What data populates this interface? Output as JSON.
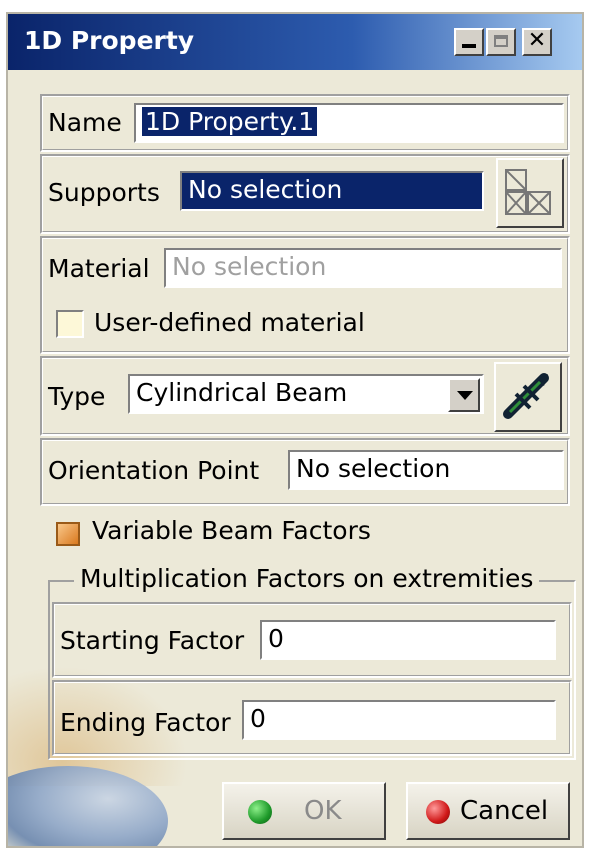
{
  "window": {
    "title": "1D Property",
    "minimize_label": "",
    "maximize_label": "",
    "close_label": "✕"
  },
  "name": {
    "label": "Name",
    "value": "1D Property.1"
  },
  "supports": {
    "label": "Supports",
    "value": "No selection",
    "icon": "selection-grid-icon"
  },
  "material": {
    "label": "Material",
    "value": "No selection",
    "checkbox_label": "User-defined material",
    "checked": false
  },
  "type": {
    "label": "Type",
    "value": "Cylindrical Beam",
    "icon": "beam-edit-icon"
  },
  "orientation": {
    "label": "Orientation Point",
    "value": "No selection"
  },
  "variable_beam": {
    "label": "Variable Beam Factors",
    "checked": true
  },
  "multiplication": {
    "legend": "Multiplication Factors on extremities",
    "starting_label": "Starting Factor",
    "starting_value": "0",
    "ending_label": "Ending Factor",
    "ending_value": "0"
  },
  "buttons": {
    "ok": "OK",
    "cancel": "Cancel"
  },
  "colors": {
    "title_bar": "#0a246a",
    "selection": "#0a246a",
    "dialog_bg": "#ece9d8",
    "ok_dot": "#1e9a2a",
    "cancel_dot": "#d01818"
  }
}
